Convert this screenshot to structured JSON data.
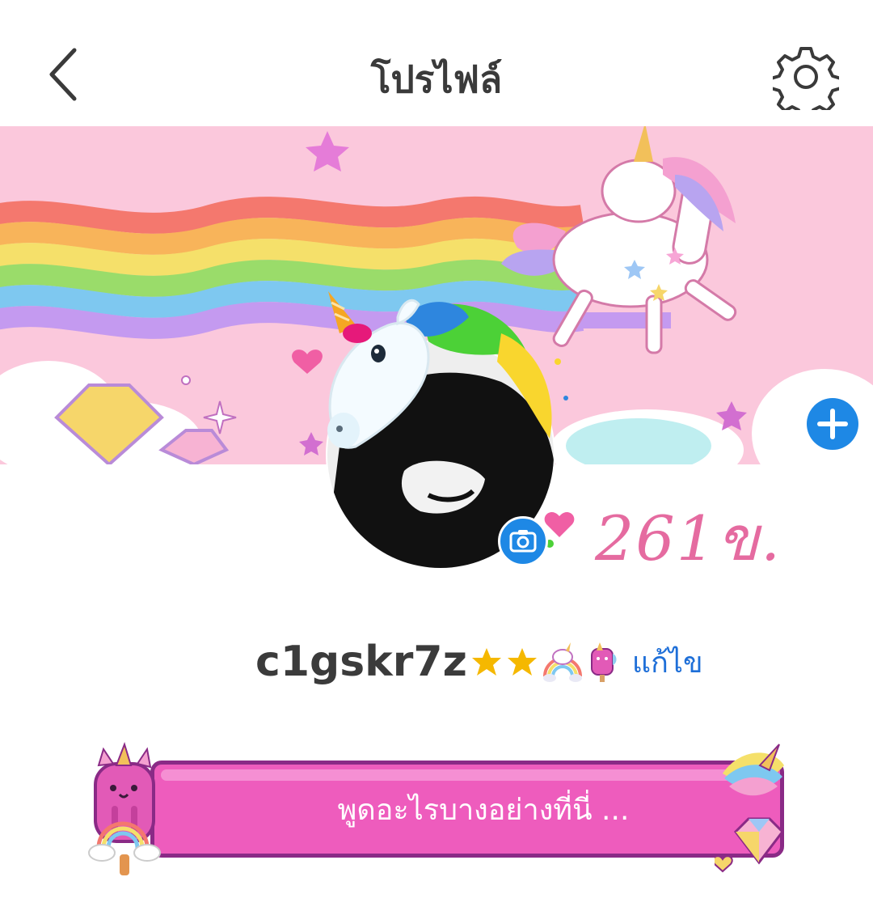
{
  "header": {
    "title": "โปรไฟล์",
    "back_icon": "chevron-left-icon",
    "settings_icon": "gear-icon"
  },
  "cover": {
    "theme": "unicorn-rainbow",
    "add_icon": "plus-icon",
    "colors": {
      "background": "#fbc8dc",
      "add_button": "#1e88e5"
    }
  },
  "avatar": {
    "camera_icon": "camera-icon",
    "handwritten_note": "261ข."
  },
  "profile": {
    "username": "c1gskr7z",
    "badges": [
      "star",
      "star",
      "unicorn-rainbow",
      "unicorn-popsicle"
    ],
    "edit_label": "แก้ไข"
  },
  "status": {
    "placeholder": "พูดอะไรบางอย่างที่นี่ ...",
    "colors": {
      "fill": "#ee5cbd",
      "border": "#8a2a86"
    }
  }
}
